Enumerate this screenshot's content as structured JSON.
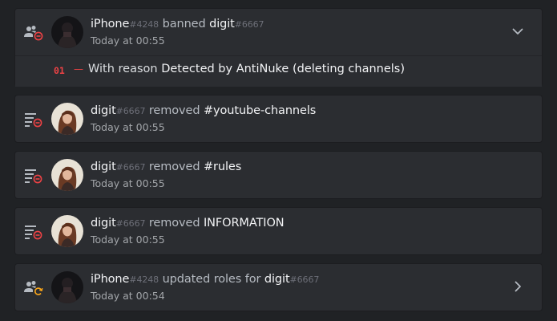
{
  "entries": [
    {
      "type": "ban",
      "user": "iPhone",
      "user_disc": "#4248",
      "action": " banned ",
      "target": "digit",
      "target_disc": "#6667",
      "time": "Today at 00:55",
      "expanded": true,
      "detail": {
        "index": "01",
        "dash": "—",
        "prefix": "With reason ",
        "reason": "Detected by AntiNuke (deleting channels)"
      }
    },
    {
      "type": "channel-delete",
      "user": "digit",
      "user_disc": "#6667",
      "action": " removed ",
      "target": "#youtube-channels",
      "time": "Today at 00:55"
    },
    {
      "type": "channel-delete",
      "user": "digit",
      "user_disc": "#6667",
      "action": " removed ",
      "target": "#rules",
      "time": "Today at 00:55"
    },
    {
      "type": "channel-delete",
      "user": "digit",
      "user_disc": "#6667",
      "action": " removed ",
      "target": "INFORMATION",
      "time": "Today at 00:55"
    },
    {
      "type": "role-update",
      "user": "iPhone",
      "user_disc": "#4248",
      "action": " updated roles for ",
      "target": "digit",
      "target_disc": "#6667",
      "time": "Today at 00:54"
    }
  ],
  "colors": {
    "danger": "#ed4245",
    "warning": "#faa61a",
    "muted_icon": "#b5bac1"
  },
  "icons": {
    "ban": "member-ban-icon",
    "channel_delete": "channel-delete-icon",
    "role_update": "member-update-icon",
    "expanded": "chevron-down-icon",
    "collapsed": "chevron-right-icon"
  }
}
